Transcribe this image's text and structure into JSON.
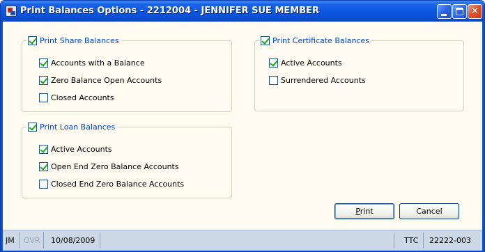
{
  "window": {
    "title": "Print Balances Options - 2212004 - JENNIFER SUE MEMBER",
    "controls": {
      "minimize": "minimize-icon",
      "maximize": "maximize-icon",
      "close": "close-icon"
    },
    "close_glyph": "✕"
  },
  "share_group": {
    "label": "Print Share Balances",
    "checked": true,
    "options": [
      {
        "label": "Accounts with a Balance",
        "checked": true
      },
      {
        "label": "Zero Balance Open Accounts",
        "checked": true
      },
      {
        "label": "Closed Accounts",
        "checked": false
      }
    ]
  },
  "certificate_group": {
    "label": "Print Certificate Balances",
    "checked": true,
    "options": [
      {
        "label": "Active Accounts",
        "checked": true
      },
      {
        "label": "Surrendered Accounts",
        "checked": false
      }
    ]
  },
  "loan_group": {
    "label": "Print Loan Balances",
    "checked": true,
    "options": [
      {
        "label": "Active Accounts",
        "checked": true
      },
      {
        "label": "Open End Zero Balance Accounts",
        "checked": true
      },
      {
        "label": "Closed End Zero Balance Accounts",
        "checked": false
      }
    ]
  },
  "buttons": {
    "print": {
      "label_prefix": "",
      "mnemonic": "P",
      "label_rest": "rint"
    },
    "cancel": {
      "label": "Cancel"
    }
  },
  "statusbar": {
    "user": "JM",
    "ovr": "OVR",
    "date": "10/08/2009",
    "ttc": "TTC",
    "code": "22222-003"
  },
  "colors": {
    "title_bar": "#0a55e0",
    "client_bg": "#fffbf0",
    "group_label": "#0046d5",
    "check_mark": "#21a121",
    "statusbar_bg": "#ccd8e6"
  }
}
